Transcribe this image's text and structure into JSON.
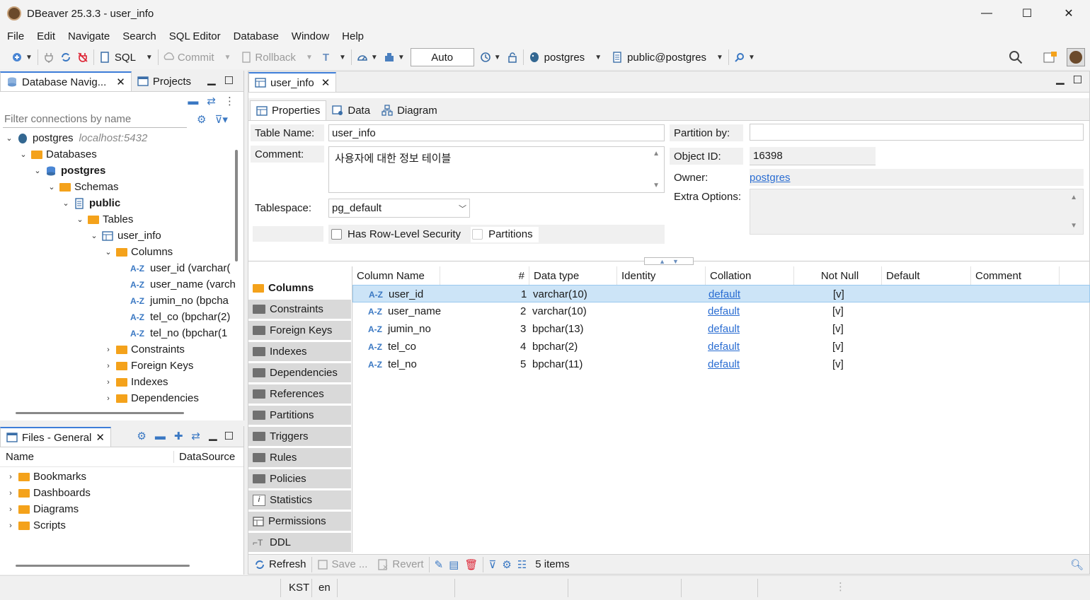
{
  "window": {
    "title": "DBeaver 25.3.3 - user_info",
    "minimize": "—",
    "maximize": "☐",
    "close": "✕"
  },
  "menu": [
    "File",
    "Edit",
    "Navigate",
    "Search",
    "SQL Editor",
    "Database",
    "Window",
    "Help"
  ],
  "toolbar": {
    "sql": "SQL",
    "commit": "Commit",
    "rollback": "Rollback",
    "mode": "Auto",
    "connection": "postgres",
    "schema": "public@postgres"
  },
  "navigator": {
    "tab_label": "Database Navig...",
    "projects_label": "Projects",
    "filter_placeholder": "Filter connections by name",
    "tree": {
      "conn": "postgres",
      "conn_host": "localhost:5432",
      "databases": "Databases",
      "db": "postgres",
      "schemas": "Schemas",
      "schema": "public",
      "tables": "Tables",
      "table": "user_info",
      "columns": "Columns",
      "cols": [
        "user_id (varchar(",
        "user_name (varch",
        "jumin_no (bpcha",
        "tel_co (bpchar(2)",
        "tel_no (bpchar(1"
      ],
      "constraints": "Constraints",
      "foreign_keys": "Foreign Keys",
      "indexes": "Indexes",
      "dependencies": "Dependencies"
    }
  },
  "files": {
    "tab_label": "Files - General",
    "col_name": "Name",
    "col_ds": "DataSource",
    "items": [
      "Bookmarks",
      "Dashboards",
      "Diagrams",
      "Scripts"
    ]
  },
  "editor": {
    "tab_label": "user_info",
    "subtabs": {
      "properties": "Properties",
      "data": "Data",
      "diagram": "Diagram"
    },
    "props": {
      "table_name_label": "Table Name:",
      "table_name": "user_info",
      "comment_label": "Comment:",
      "comment": "사용자에 대한 정보 테이블",
      "tablespace_label": "Tablespace:",
      "tablespace": "pg_default",
      "rls_label": "Has Row-Level Security",
      "partitions_label": "Partitions",
      "partition_by_label": "Partition by:",
      "partition_by": "",
      "object_id_label": "Object ID:",
      "object_id": "16398",
      "owner_label": "Owner:",
      "owner": "postgres",
      "extra_label": "Extra Options:"
    },
    "sidetabs": [
      "Columns",
      "Constraints",
      "Foreign Keys",
      "Indexes",
      "Dependencies",
      "References",
      "Partitions",
      "Triggers",
      "Rules",
      "Policies",
      "Statistics",
      "Permissions",
      "DDL"
    ],
    "grid": {
      "headers": [
        "Column Name",
        "#",
        "Data type",
        "Identity",
        "Collation",
        "Not Null",
        "Default",
        "Comment"
      ],
      "rows": [
        {
          "name": "user_id",
          "num": "1",
          "type": "varchar(10)",
          "collation": "default",
          "notnull": "[v]"
        },
        {
          "name": "user_name",
          "num": "2",
          "type": "varchar(10)",
          "collation": "default",
          "notnull": "[v]"
        },
        {
          "name": "jumin_no",
          "num": "3",
          "type": "bpchar(13)",
          "collation": "default",
          "notnull": "[v]"
        },
        {
          "name": "tel_co",
          "num": "4",
          "type": "bpchar(2)",
          "collation": "default",
          "notnull": "[v]"
        },
        {
          "name": "tel_no",
          "num": "5",
          "type": "bpchar(11)",
          "collation": "default",
          "notnull": "[v]"
        }
      ]
    },
    "bottom": {
      "refresh": "Refresh",
      "save": "Save ...",
      "revert": "Revert",
      "count": "5 items"
    }
  },
  "status": {
    "tz": "KST",
    "lang": "en"
  }
}
